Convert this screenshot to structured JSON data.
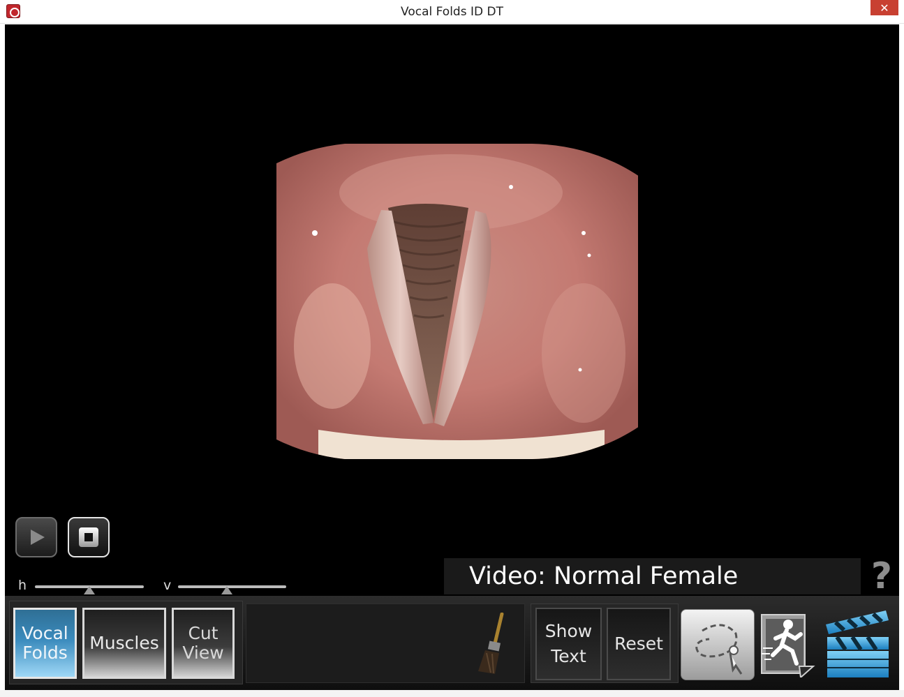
{
  "window": {
    "title": "Vocal Folds ID DT",
    "close_glyph": "✕",
    "app_icon": "app-logo-icon"
  },
  "video": {
    "caption": "Video: Normal Female",
    "help_glyph": "?"
  },
  "playback": {
    "play_icon": "play-icon",
    "stop_icon": "stop-icon"
  },
  "sliders": {
    "h_label": "h",
    "h_value": 0.5,
    "v_label": "v",
    "v_value": 0.45
  },
  "tabs": [
    {
      "line1": "Vocal",
      "line2": "Folds",
      "active": true
    },
    {
      "line1": "Muscles",
      "line2": "",
      "active": false
    },
    {
      "line1": "Cut",
      "line2": "View",
      "active": false
    }
  ],
  "actions": {
    "show_text_line1": "Show",
    "show_text_line2": "Text",
    "reset": "Reset"
  },
  "tools": {
    "paint": "paintbrush-icon",
    "lasso": "lasso-pointer-icon",
    "runner": "running-figure-icon",
    "clapper": "clapperboard-icon"
  },
  "colors": {
    "active_tab": "#3b8bbd",
    "background": "#000000"
  }
}
